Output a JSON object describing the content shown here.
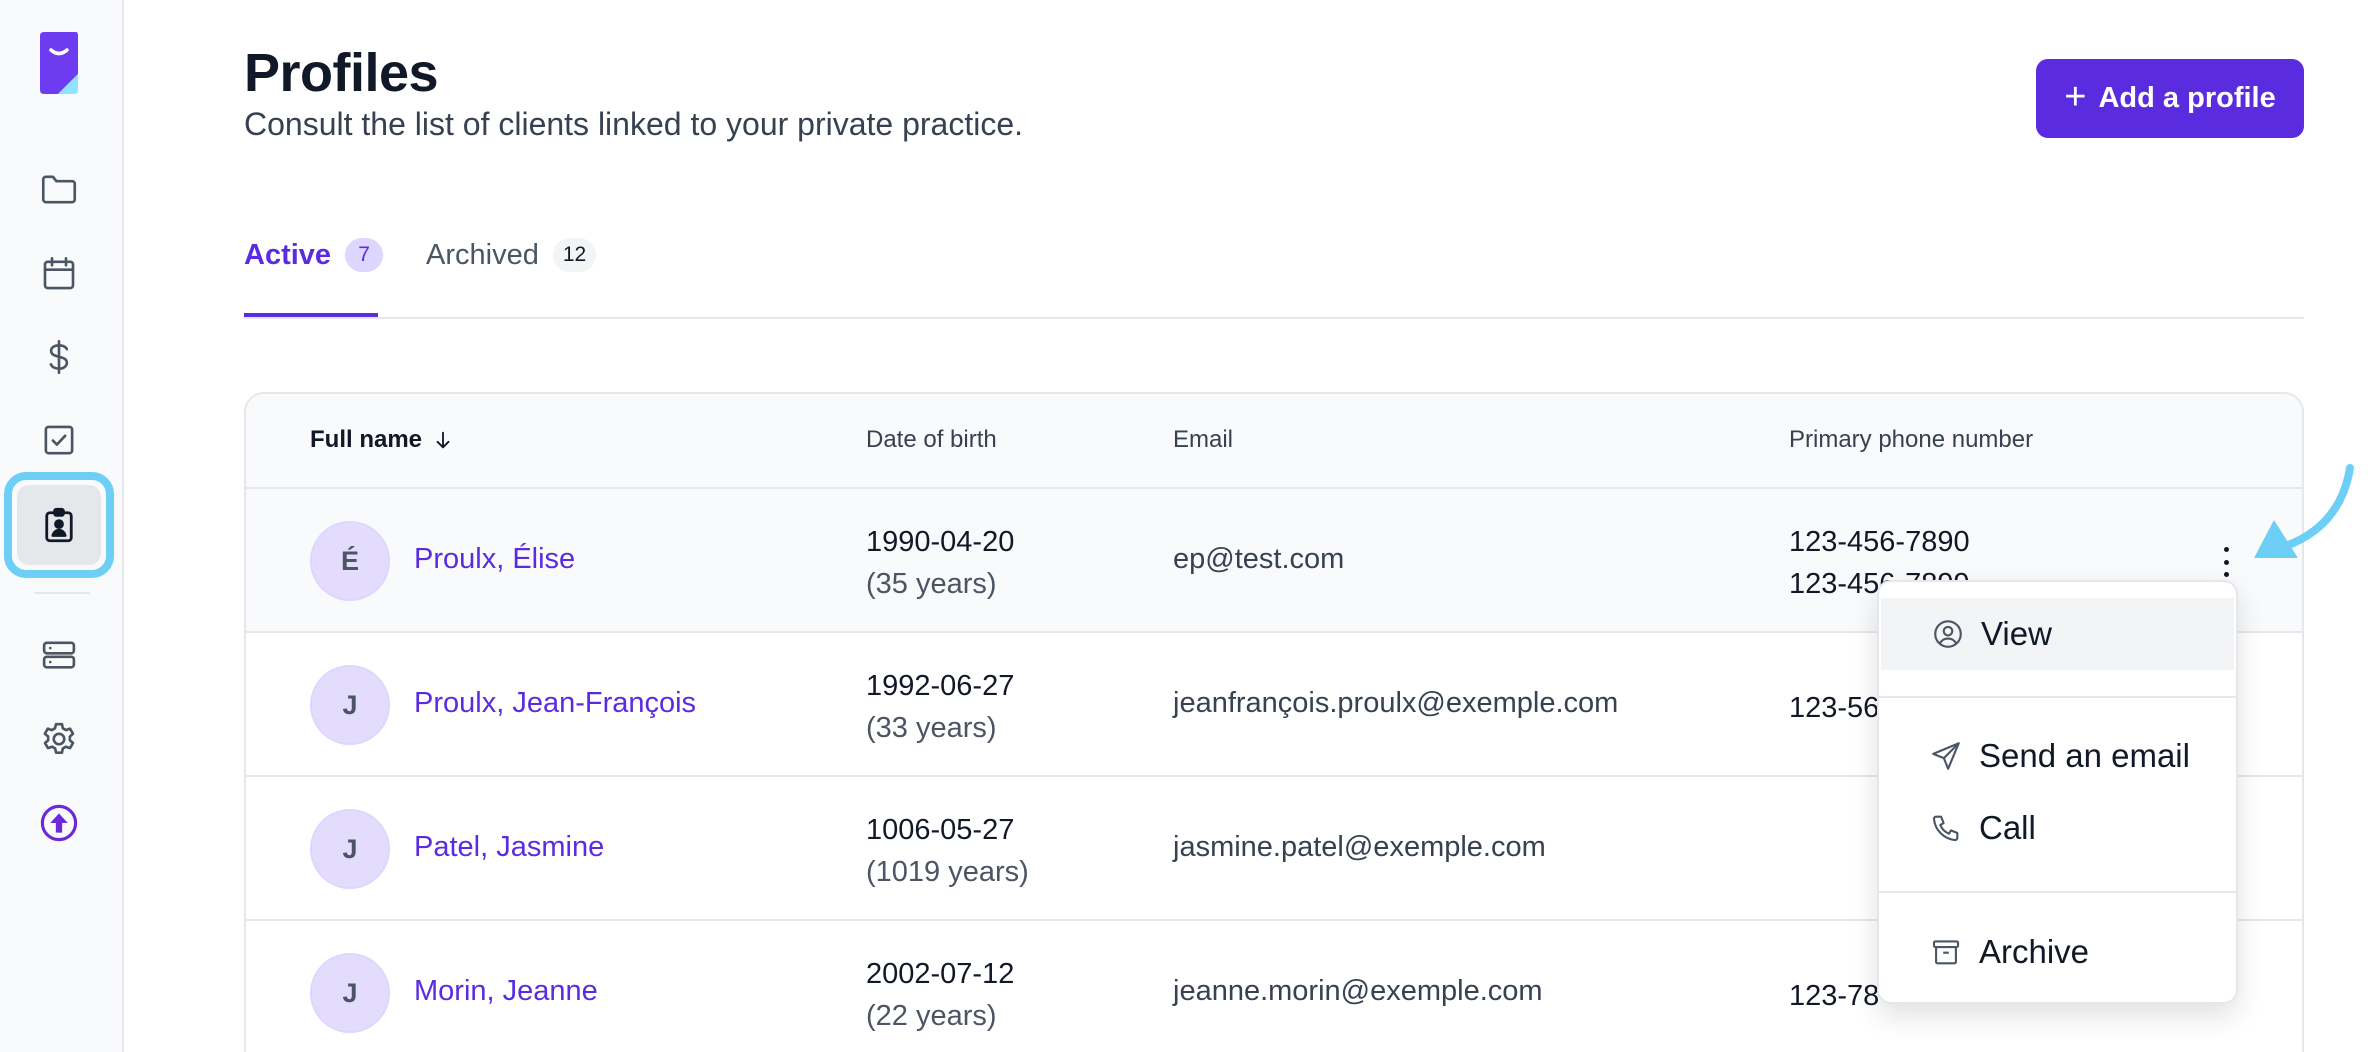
{
  "header": {
    "title": "Profiles",
    "subtitle": "Consult the list of clients linked to your private practice.",
    "add_button_label": "Add a profile",
    "add_button_icon": "plus-icon"
  },
  "sidebar": {
    "icons": [
      "logo",
      "folder-icon",
      "calendar-icon",
      "dollar-icon",
      "checkbox-icon",
      "clipboard-user-icon",
      "server-icon",
      "gear-icon",
      "upgrade-arrow-icon"
    ],
    "active_item": "clipboard-user-icon"
  },
  "tabs": [
    {
      "label": "Active",
      "count": "7",
      "active": true
    },
    {
      "label": "Archived",
      "count": "12",
      "active": false
    }
  ],
  "table": {
    "columns": {
      "name": "Full name",
      "dob": "Date of birth",
      "email": "Email",
      "phone": "Primary phone number"
    },
    "rows": [
      {
        "initial": "É",
        "name": "Proulx, Élise",
        "dob": "1990-04-20",
        "age": "(35 years)",
        "email": "ep@test.com",
        "phone1": "123-456-7890",
        "phone2": "123-456-7899"
      },
      {
        "initial": "J",
        "name": "Proulx, Jean-François",
        "dob": "1992-06-27",
        "age": "(33 years)",
        "email": "jeanfrançois.proulx@exemple.com",
        "phone1": "123-56",
        "phone2": ""
      },
      {
        "initial": "J",
        "name": "Patel, Jasmine",
        "dob": "1006-05-27",
        "age": "(1019 years)",
        "email": "jasmine.patel@exemple.com",
        "phone1": "",
        "phone2": ""
      },
      {
        "initial": "J",
        "name": "Morin, Jeanne",
        "dob": "2002-07-12",
        "age": "(22 years)",
        "email": "jeanne.morin@exemple.com",
        "phone1": "123-78",
        "phone2": ""
      }
    ]
  },
  "menu": {
    "items": [
      {
        "label": "View",
        "icon": "user-circle-icon"
      },
      {
        "label": "Send an email",
        "icon": "paper-plane-icon"
      },
      {
        "label": "Call",
        "icon": "phone-icon"
      },
      {
        "label": "Archive",
        "icon": "archive-box-icon"
      }
    ]
  },
  "colors": {
    "accent": "#5b2bdf",
    "highlight_ring": "#6dcff6"
  }
}
